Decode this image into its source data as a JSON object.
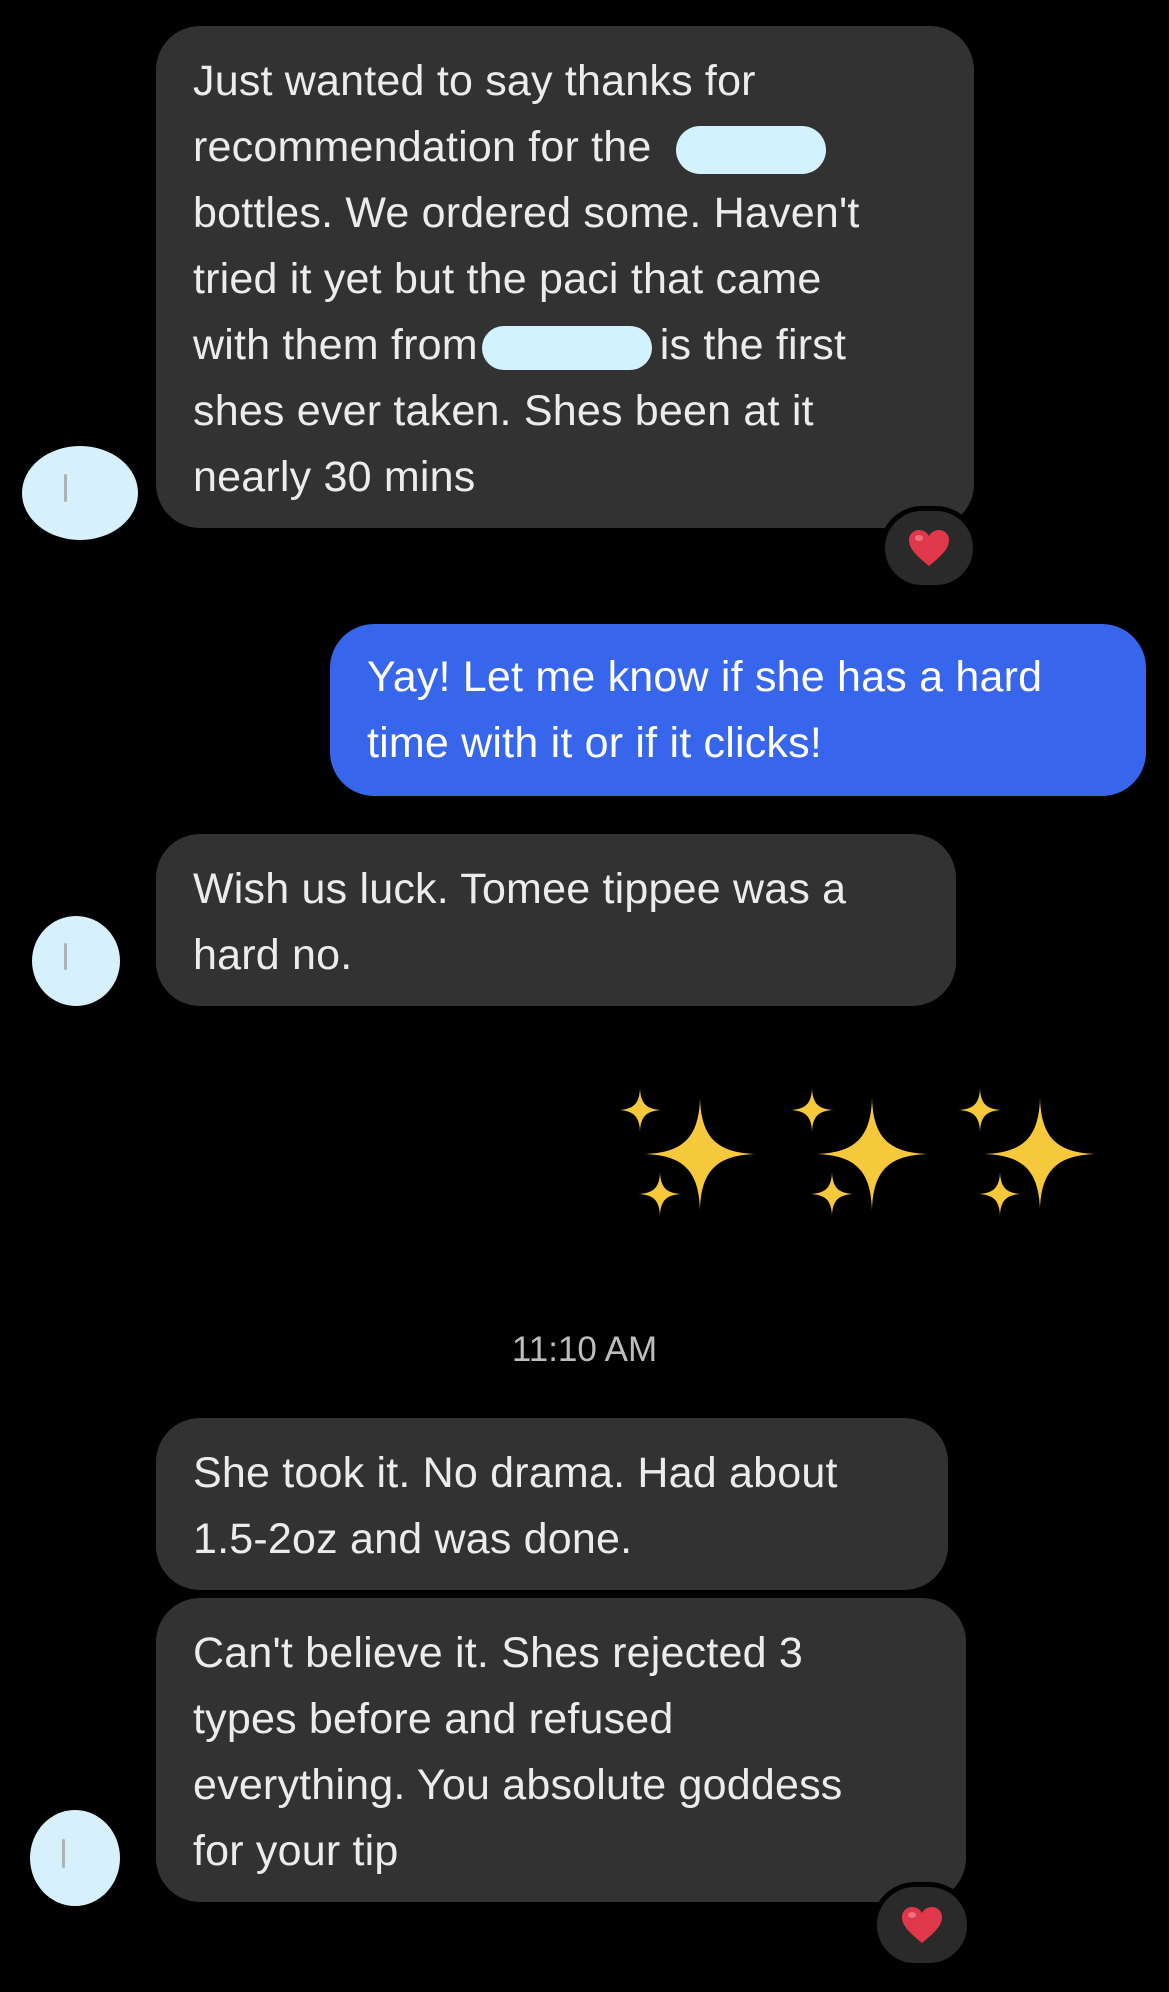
{
  "conversation": {
    "messages": [
      {
        "direction": "incoming",
        "lines": [
          "Just wanted to say thanks for",
          "recommendation for the",
          "bottles. We ordered some. Haven't",
          "tried it yet but the paci that came",
          "with them from",
          "is the first",
          "shes ever taken. Shes been at it",
          "nearly 30 mins"
        ],
        "reaction": "heart"
      },
      {
        "direction": "outgoing",
        "lines": [
          "Yay! Let me know if she has a hard",
          "time with it or if it clicks!"
        ]
      },
      {
        "direction": "incoming",
        "lines": [
          "Wish us luck. Tomee tippee was a",
          "hard no."
        ]
      },
      {
        "direction": "outgoing",
        "emoji": "✨✨✨"
      },
      {
        "direction": "incoming",
        "lines": [
          "She took it. No drama. Had about",
          "1.5-2oz and was done."
        ]
      },
      {
        "direction": "incoming",
        "lines": [
          "Can't believe it. Shes rejected 3",
          "types before and refused",
          "everything. You absolute goddess",
          "for your tip"
        ],
        "reaction": "heart"
      }
    ],
    "timestamp": "11:10 AM"
  },
  "colors": {
    "background": "#000000",
    "incoming_bubble": "#323232",
    "outgoing_bubble": "#3766ec",
    "redaction": "#d2f2fd",
    "heart": "#e0384a",
    "sparkle": "#f6c93c"
  },
  "icons": {
    "reaction": "heart-icon",
    "sparkle": "sparkles-emoji"
  }
}
